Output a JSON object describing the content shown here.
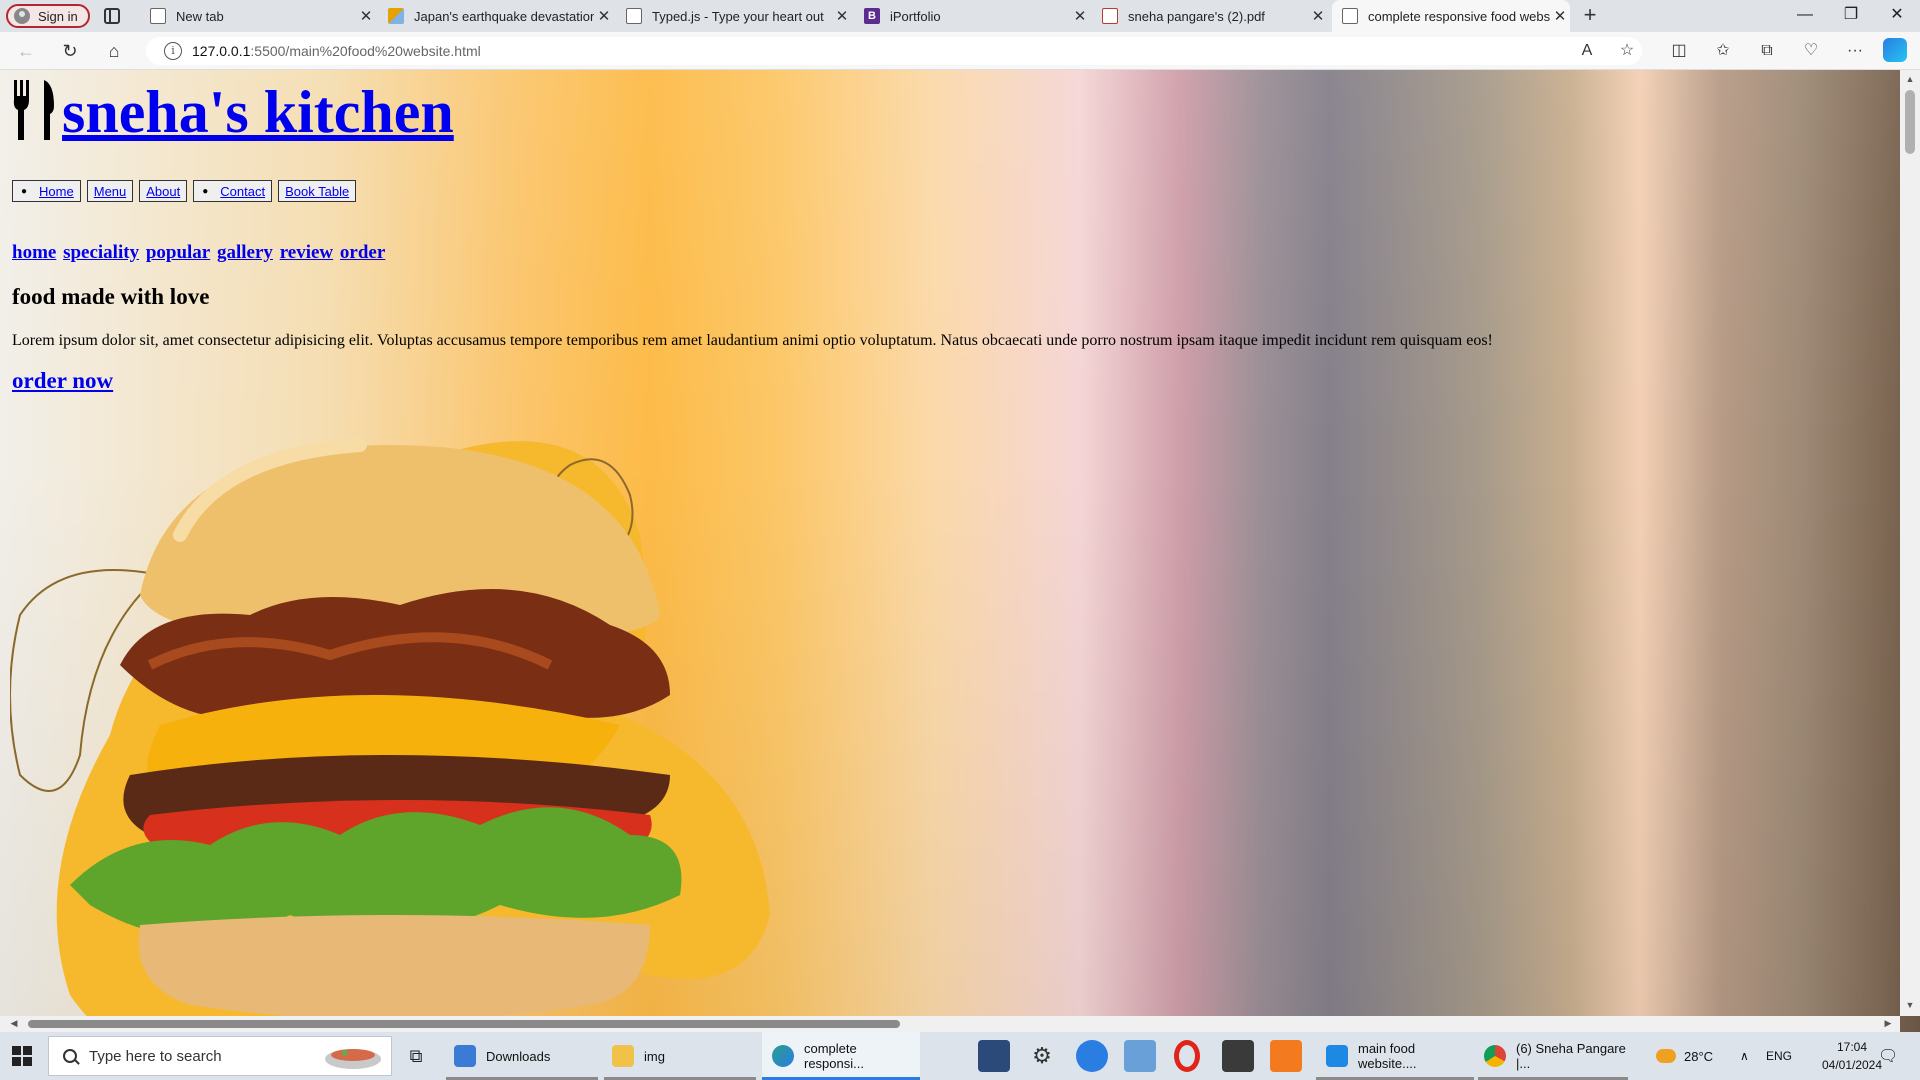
{
  "browser": {
    "sign_in_label": "Sign in",
    "tabs": [
      {
        "title": "New tab",
        "icon": "page-icon"
      },
      {
        "title": "Japan's earthquake devastation c",
        "icon": "news-favicon"
      },
      {
        "title": "Typed.js - Type your heart out",
        "icon": "page-icon"
      },
      {
        "title": "iPortfolio",
        "icon": "bootstrap-favicon"
      },
      {
        "title": "sneha pangare's (2).pdf",
        "icon": "pdf-icon"
      },
      {
        "title": "complete responsive food websi",
        "icon": "page-icon",
        "active": true
      }
    ],
    "url_host": "127.0.0.1",
    "url_path": ":5500/main%20food%20website.html"
  },
  "page": {
    "logo_text": "sneha's kitchen",
    "buttons": [
      {
        "label": "Home",
        "bullet": true
      },
      {
        "label": "Menu",
        "bullet": false
      },
      {
        "label": "About",
        "bullet": false
      },
      {
        "label": "Contact",
        "bullet": true
      },
      {
        "label": "Book Table",
        "bullet": false
      }
    ],
    "section_links": [
      "home",
      "speciality",
      "popular",
      "gallery",
      "review",
      "order"
    ],
    "tagline": "food made with love",
    "description": "Lorem ipsum dolor sit, amet consectetur adipisicing elit. Voluptas accusamus tempore temporibus rem amet laudantium animi optio voluptatum. Natus obcaecati unde porro nostrum ipsam itaque impedit incidunt rem quisquam eos!",
    "order_link": "order now"
  },
  "taskbar": {
    "search_placeholder": "Type here to search",
    "apps": [
      {
        "label": "Downloads",
        "icon": "download-folder-icon"
      },
      {
        "label": "img",
        "icon": "folder-icon"
      },
      {
        "label": "complete responsi...",
        "icon": "edge-icon"
      },
      {
        "label": "main food website....",
        "icon": "vscode-icon"
      },
      {
        "label": "(6) Sneha Pangare |...",
        "icon": "chrome-icon"
      }
    ],
    "weather": "28°C",
    "language": "ENG",
    "time": "17:04",
    "date": "04/01/2024"
  },
  "colors": {
    "link": "#0000ee",
    "sign_in_border": "#b3262f",
    "accent": "#2a7de1"
  }
}
